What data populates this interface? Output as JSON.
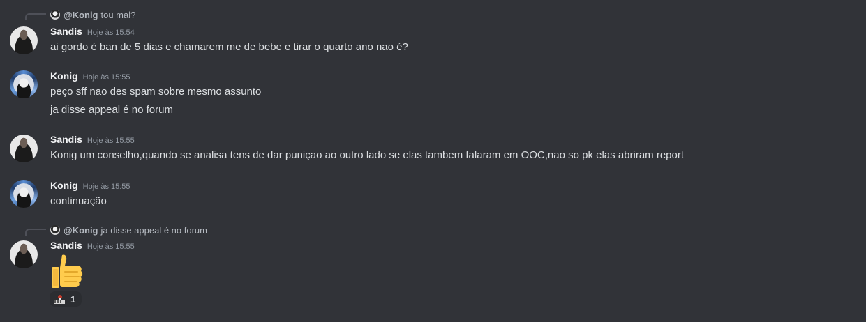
{
  "colors": {
    "background": "#313338",
    "username": "#f2f3f5",
    "text": "#dbdee1",
    "muted": "#949ba4",
    "reaction_bg": "#2b2d31"
  },
  "messages": [
    {
      "reply": {
        "name": "@Konig",
        "text": "tou mal?"
      },
      "author": "Sandis",
      "avatar": "sandis-avatar",
      "time": "Hoje às 15:54",
      "lines": [
        "ai gordo é ban de 5 dias e chamarem me de bebe e tirar o quarto ano nao é?"
      ]
    },
    {
      "author": "Konig",
      "avatar": "konig-avatar",
      "time": "Hoje às 15:55",
      "lines": [
        "peço sff nao des spam sobre mesmo assunto",
        "ja disse appeal é no forum"
      ]
    },
    {
      "author": "Sandis",
      "avatar": "sandis-avatar",
      "time": "Hoje às 15:55",
      "lines": [
        "Konig um conselho,quando se analisa tens de dar puniçao ao outro lado se elas tambem falaram em OOC,nao so pk elas abriram report"
      ]
    },
    {
      "author": "Konig",
      "avatar": "konig-avatar",
      "time": "Hoje às 15:55",
      "lines": [
        "continuação"
      ]
    },
    {
      "reply": {
        "name": "@Konig",
        "text": "ja disse appeal é no forum"
      },
      "author": "Sandis",
      "avatar": "sandis-avatar",
      "time": "Hoje às 15:55",
      "emoji": "thumbs-up-icon",
      "reaction": {
        "emoji": "custom-reaction-icon",
        "count": "1"
      }
    }
  ]
}
